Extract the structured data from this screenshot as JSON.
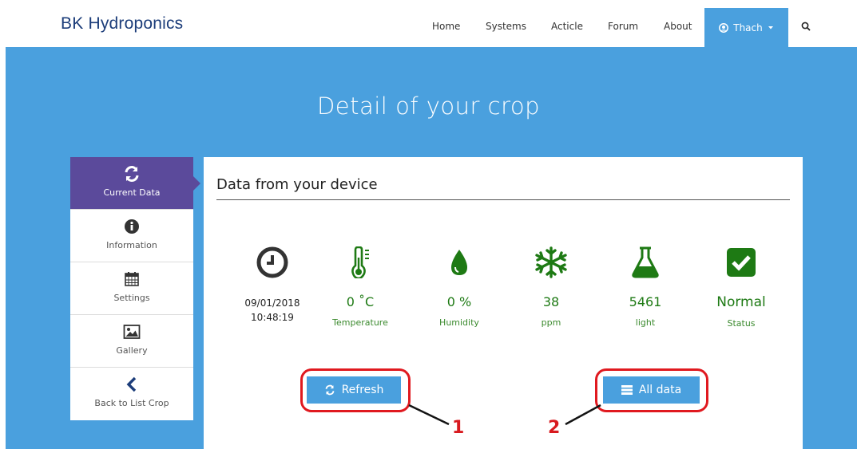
{
  "brand": "BK Hydroponics",
  "nav": {
    "items": [
      "Home",
      "Systems",
      "Acticle",
      "Forum",
      "About"
    ],
    "user": "Thach"
  },
  "hero": {
    "title": "Detail of your crop"
  },
  "sidebar": {
    "items": [
      {
        "label": "Current Data",
        "icon": "refresh-icon",
        "active": true
      },
      {
        "label": "Information",
        "icon": "info-icon"
      },
      {
        "label": "Settings",
        "icon": "calendar-icon"
      },
      {
        "label": "Gallery",
        "icon": "image-icon"
      },
      {
        "label": "Back to List Crop",
        "icon": "chevron-left-icon"
      }
    ]
  },
  "content": {
    "title": "Data from your device",
    "metrics": {
      "time": {
        "date": "09/01/2018",
        "clock": "10:48:19",
        "icon": "clock-icon"
      },
      "temperature": {
        "value": "0 ˚C",
        "label": "Temperature",
        "icon": "thermometer-icon"
      },
      "humidity": {
        "value": "0 %",
        "label": "Humidity",
        "icon": "droplet-icon"
      },
      "ppm": {
        "value": "38",
        "label": "ppm",
        "icon": "snowflake-icon"
      },
      "light": {
        "value": "5461",
        "label": "light",
        "icon": "flask-icon"
      },
      "status": {
        "value": "Normal",
        "label": "Status",
        "icon": "check-square-icon"
      }
    },
    "refresh_label": "Refresh",
    "alldata_label": "All data"
  },
  "annotations": [
    "1",
    "2"
  ],
  "colors": {
    "accent": "#4aa0de",
    "active": "#5b4a9b",
    "green": "#2b7a1e",
    "annotation": "#e0191f"
  }
}
